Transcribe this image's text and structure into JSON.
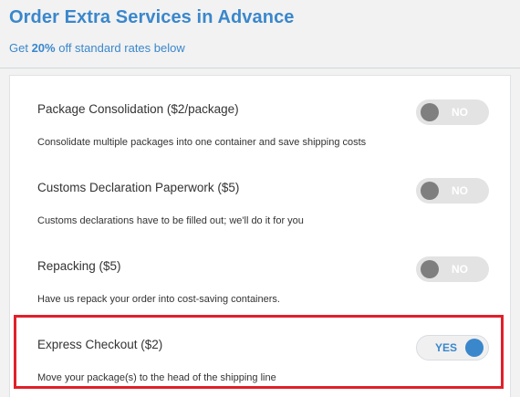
{
  "header": {
    "title": "Order Extra Services in Advance",
    "subtitle_prefix": "Get ",
    "subtitle_discount": "20%",
    "subtitle_suffix": " off standard rates below"
  },
  "services": [
    {
      "title": "Package Consolidation ($2/package)",
      "description": "Consolidate multiple packages into one container and save shipping costs",
      "toggle_label": "NO",
      "enabled": false
    },
    {
      "title": "Customs Declaration Paperwork ($5)",
      "description": "Customs declarations have to be filled out; we'll do it for you",
      "toggle_label": "NO",
      "enabled": false
    },
    {
      "title": "Repacking ($5)",
      "description": "Have us repack your order into cost-saving containers.",
      "toggle_label": "NO",
      "enabled": false
    },
    {
      "title": "Express Checkout ($2)",
      "description": "Move your package(s) to the head of the shipping line",
      "toggle_label": "YES",
      "enabled": true
    }
  ],
  "colors": {
    "accent": "#3a87cc",
    "highlight": "#e0202a",
    "toggle_off_knob": "#7f7f7f"
  }
}
